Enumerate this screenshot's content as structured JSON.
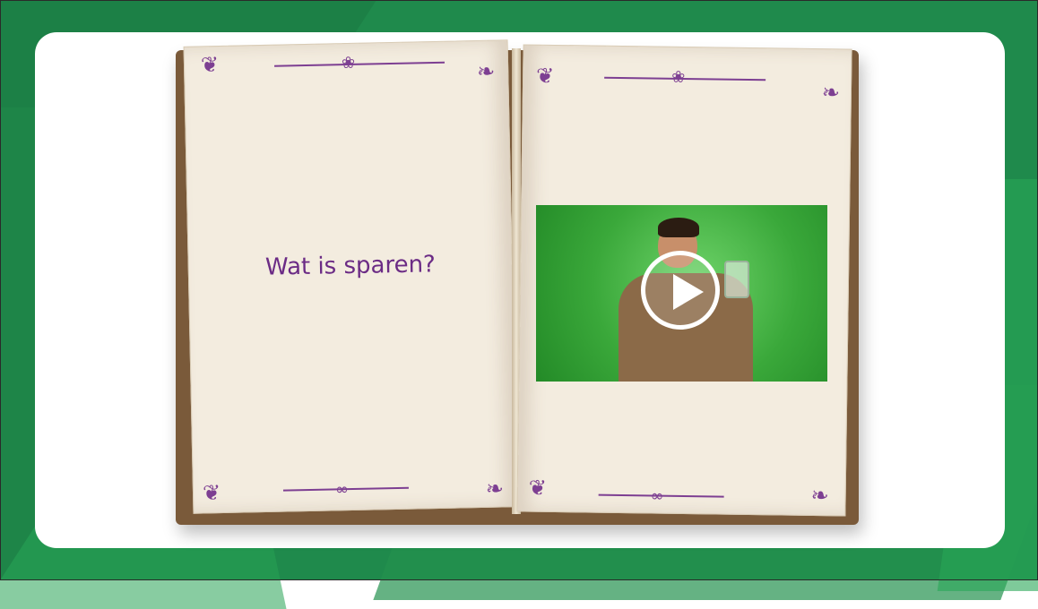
{
  "slide": {
    "title": "Wat is sparen?"
  },
  "colors": {
    "background": "#1f8a4c",
    "card": "#ffffff",
    "title_text": "#6b2b85",
    "ornament": "#7d3f92",
    "video_bg": "#3aa83a"
  },
  "icons": {
    "play": "play-icon",
    "corner_ornament": "corner-ornament-icon"
  }
}
